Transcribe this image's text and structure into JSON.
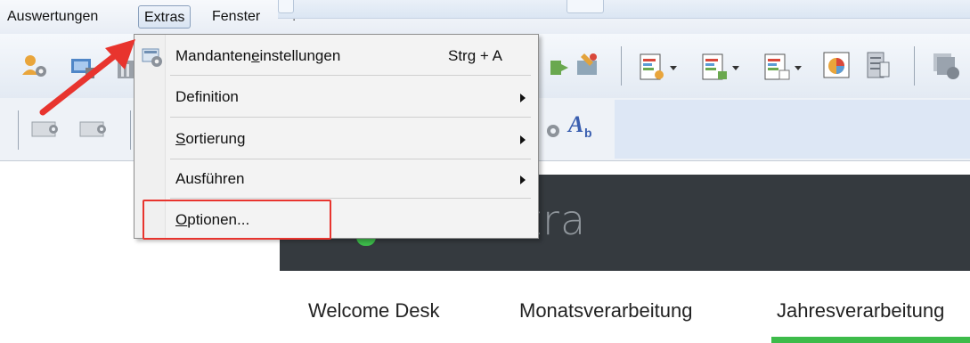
{
  "menubar": {
    "items": [
      {
        "label": "Auswertungen"
      },
      {
        "label": "Extras"
      },
      {
        "label": "Fenster"
      },
      {
        "label": "?"
      }
    ]
  },
  "extras_menu": {
    "items": [
      {
        "label_pre": "Mandanten",
        "label_ul": "e",
        "label_post": "instellungen",
        "shortcut": "Strg + A",
        "icon": "settings-gear-icon"
      },
      {
        "label": "Definition",
        "submenu": true
      },
      {
        "label_ul": "S",
        "label_post": "ortierung",
        "submenu": true
      },
      {
        "label": "Ausführen",
        "submenu": true
      },
      {
        "label_ul": "O",
        "label_post": "ptionen...",
        "highlighted": true
      }
    ]
  },
  "banner": {
    "brand_fragment": "tra"
  },
  "nav_tabs": [
    {
      "label": "Welcome Desk"
    },
    {
      "label": "Monatsverarbeitung"
    },
    {
      "label": "Jahresverarbeitung",
      "active": true
    }
  ],
  "colors": {
    "annotation_red": "#e8342e",
    "accent_green": "#3dbb4a",
    "banner_dark": "#353a3f"
  }
}
